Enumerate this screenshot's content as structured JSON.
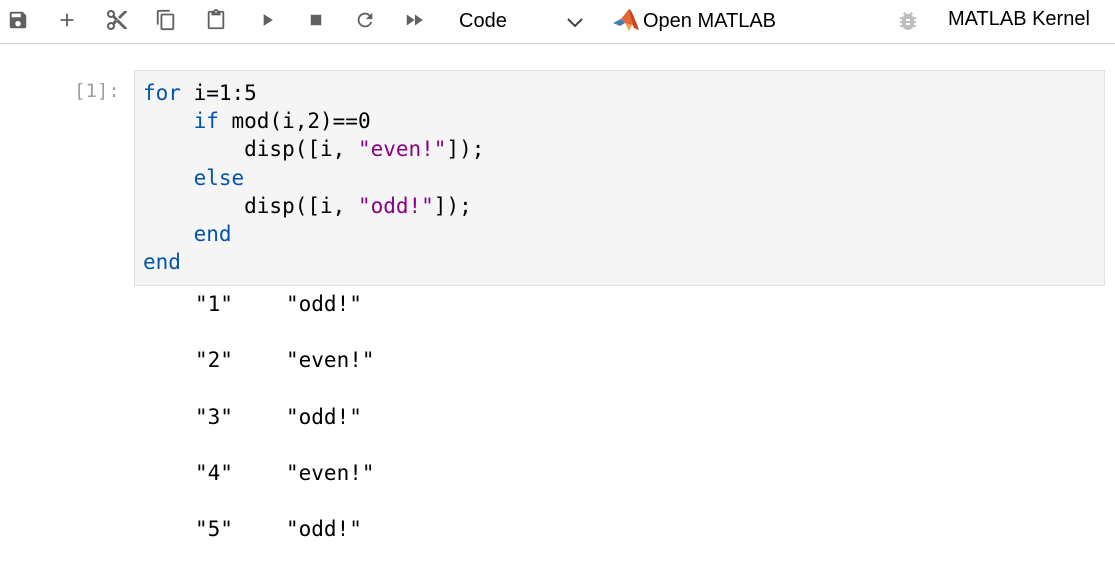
{
  "toolbar": {
    "cell_type": "Code",
    "open_matlab_label": "Open MATLAB",
    "kernel_name": "MATLAB Kernel"
  },
  "cell": {
    "prompt": "[1]:",
    "code": {
      "l1_kw": "for",
      "l1_rest": " i=1:5",
      "l2_indent": "    ",
      "l2_kw": "if",
      "l2_rest": " mod(i,2)==0",
      "l3_pre": "        disp([i, ",
      "l3_str": "\"even!\"",
      "l3_post": "]);",
      "l4_indent": "    ",
      "l4_kw": "else",
      "l5_pre": "        disp([i, ",
      "l5_str": "\"odd!\"",
      "l5_post": "]);",
      "l6_indent": "    ",
      "l6_kw": "end",
      "l7_kw": "end"
    },
    "output": [
      [
        "\"1\"",
        "\"odd!\""
      ],
      [
        "\"2\"",
        "\"even!\""
      ],
      [
        "\"3\"",
        "\"odd!\""
      ],
      [
        "\"4\"",
        "\"even!\""
      ],
      [
        "\"5\"",
        "\"odd!\""
      ]
    ]
  },
  "icons": [
    "save-icon",
    "add-icon",
    "cut-icon",
    "copy-icon",
    "paste-icon",
    "run-icon",
    "stop-icon",
    "restart-icon",
    "fast-forward-icon",
    "chevron-down-icon",
    "matlab-logo-icon",
    "bug-icon"
  ],
  "colors": {
    "keyword": "#0055aa",
    "string": "#880088",
    "prompt": "#9e9e9e",
    "icon": "#616161"
  }
}
